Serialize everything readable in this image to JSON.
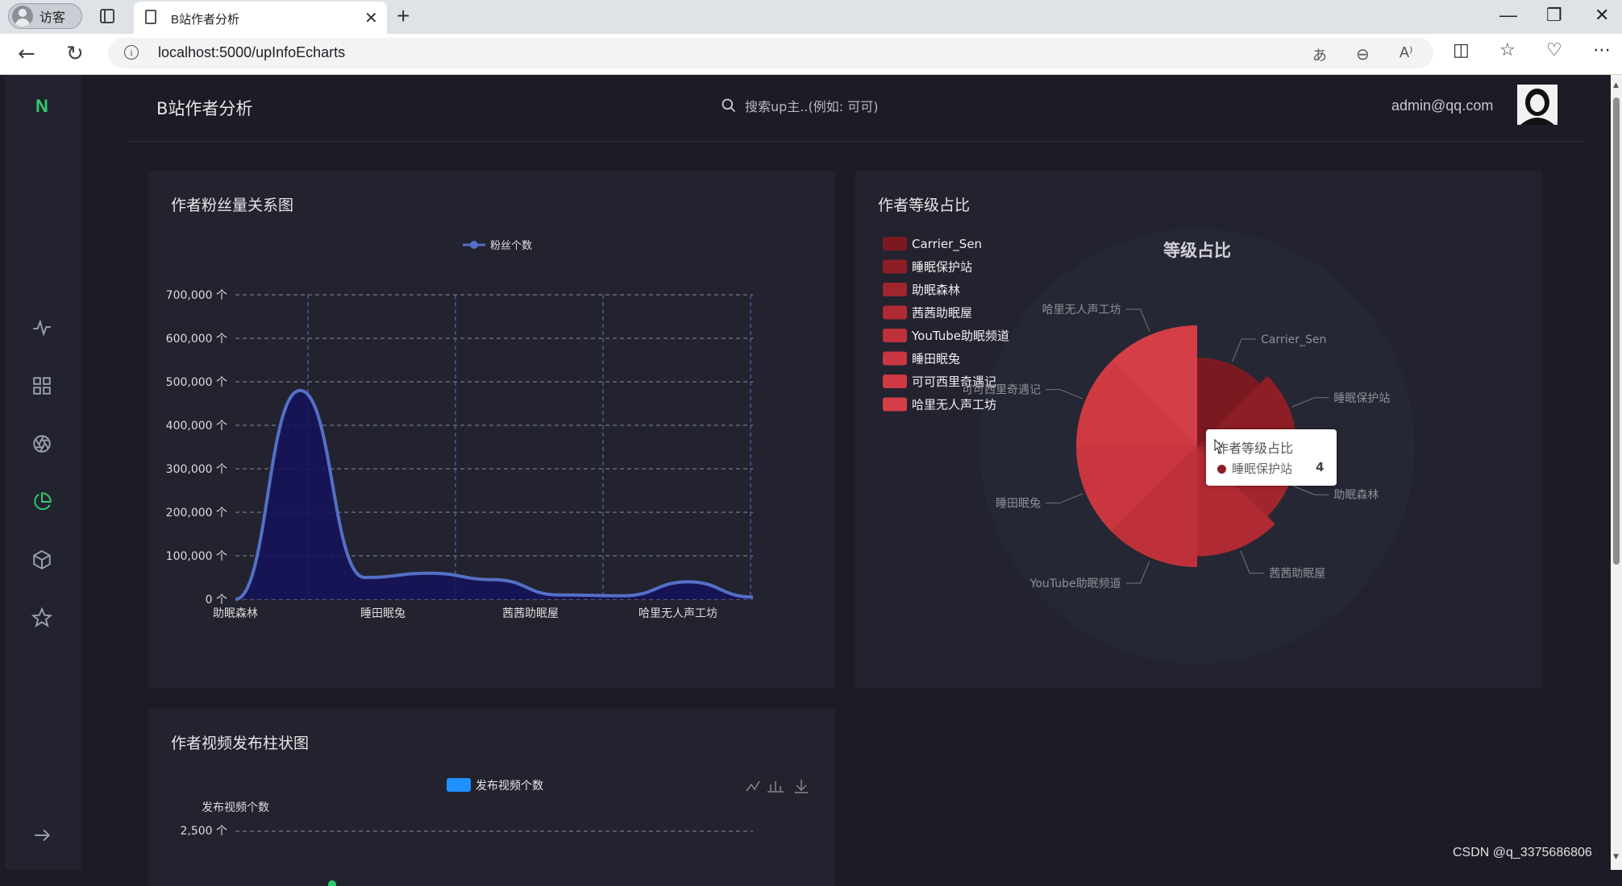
{
  "browser": {
    "profile_label": "访客",
    "tab_title": "B站作者分析",
    "close_glyph": "✕",
    "new_tab_glyph": "+",
    "url": "localhost:5000/upInfoEcharts",
    "info_glyph": "i"
  },
  "header": {
    "logo": "N",
    "title": "B站作者分析",
    "search_placeholder": "搜索up主..(例如: 可可)",
    "user_email": "admin@qq.com"
  },
  "cards": {
    "fans": {
      "title": "作者粉丝量关系图"
    },
    "level": {
      "title": "作者等级占比"
    },
    "videos": {
      "title": "作者视频发布柱状图"
    }
  },
  "fans_chart": {
    "type": "line",
    "legend": "粉丝个数",
    "x": [
      "助眠森林",
      "睡田眠兔",
      "茜茜助眠屋",
      "哈里无人声工坊"
    ],
    "y_ticks": [
      "700,000 个",
      "600,000 个",
      "500,000 个",
      "400,000 个",
      "300,000 个",
      "200,000 个",
      "100,000 个",
      "0 个"
    ],
    "ylim": [
      0,
      700000
    ],
    "series": [
      0,
      480000,
      50000,
      60000,
      45000,
      10000,
      8000,
      40000,
      5000
    ],
    "colors": {
      "line": "#5470c6",
      "area": "#14125a"
    }
  },
  "level_chart": {
    "type": "pie",
    "title": "等级占比",
    "legend": [
      "Carrier_Sen",
      "睡眠保护站",
      "助眠森林",
      "茜茜助眠屋",
      "YouTube助眠频道",
      "睡田眠兔",
      "可可西里奇遇记",
      "哈里无人声工坊"
    ],
    "values": [
      3,
      4,
      4,
      5,
      6,
      6,
      6,
      6
    ],
    "labels": [
      "Carrier_Sen",
      "睡眠保护站",
      "助眠森林",
      "茜茜助眠屋",
      "YouTube助眠频道",
      "睡田眠兔",
      "可可西里奇遇记",
      "哈里无人声工坊"
    ],
    "colors": [
      "#7a1a20",
      "#8e1e26",
      "#a0252d",
      "#b02a33",
      "#bf3139",
      "#c9363f",
      "#cf3a42",
      "#d43e46"
    ]
  },
  "tooltip": {
    "title": "作者等级占比",
    "name": "睡眠保护站",
    "value": "4"
  },
  "video_chart": {
    "type": "bar",
    "legend": "发布视频个数",
    "ylabel": "发布视频个数",
    "y_ticks": [
      "2,500 个"
    ],
    "legend_color": "#1e90ff"
  },
  "watermark": "CSDN @q_3375686806"
}
